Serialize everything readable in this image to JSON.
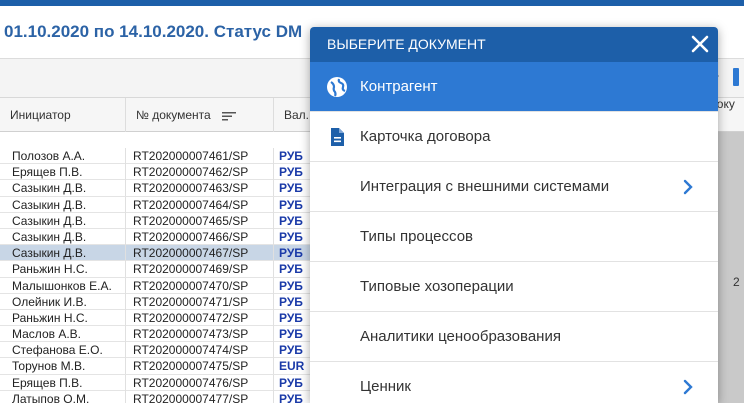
{
  "page": {
    "title": "01.10.2020 по 14.10.2020. Статус DM"
  },
  "table": {
    "columns": [
      "Инициатор",
      "№ документа",
      "Вал."
    ],
    "right_header": "атоку",
    "right_value": "2",
    "rows": [
      {
        "initiator": "Полозов А.А.",
        "doc": "RT202000007461/SP",
        "cur": "РУБ"
      },
      {
        "initiator": "Ерящев П.В.",
        "doc": "RT202000007462/SP",
        "cur": "РУБ"
      },
      {
        "initiator": "Сазыкин Д.В.",
        "doc": "RT202000007463/SP",
        "cur": "РУБ"
      },
      {
        "initiator": "Сазыкин Д.В.",
        "doc": "RT202000007464/SP",
        "cur": "РУБ"
      },
      {
        "initiator": "Сазыкин Д.В.",
        "doc": "RT202000007465/SP",
        "cur": "РУБ"
      },
      {
        "initiator": "Сазыкин Д.В.",
        "doc": "RT202000007466/SP",
        "cur": "РУБ"
      },
      {
        "initiator": "Сазыкин Д.В.",
        "doc": "RT202000007467/SP",
        "cur": "РУБ"
      },
      {
        "initiator": "Раньжин Н.С.",
        "doc": "RT202000007469/SP",
        "cur": "РУБ"
      },
      {
        "initiator": "Малышонков Е.А.",
        "doc": "RT202000007470/SP",
        "cur": "РУБ"
      },
      {
        "initiator": "Олейник И.В.",
        "doc": "RT202000007471/SP",
        "cur": "РУБ"
      },
      {
        "initiator": "Раньжин Н.С.",
        "doc": "RT202000007472/SP",
        "cur": "РУБ"
      },
      {
        "initiator": "Маслов А.В.",
        "doc": "RT202000007473/SP",
        "cur": "РУБ"
      },
      {
        "initiator": "Стефанова Е.О.",
        "doc": "RT202000007474/SP",
        "cur": "РУБ"
      },
      {
        "initiator": "Торунов М.В.",
        "doc": "RT202000007475/SP",
        "cur": "EUR"
      },
      {
        "initiator": "Ерящев П.В.",
        "doc": "RT202000007476/SP",
        "cur": "РУБ"
      },
      {
        "initiator": "Латыпов О.М.",
        "doc": "RT202000007477/SP",
        "cur": "РУБ"
      }
    ],
    "selected_row": 6
  },
  "modal": {
    "title": "ВЫБЕРИТЕ ДОКУМЕНТ",
    "items": [
      {
        "label": "Контрагент",
        "icon": "globe-icon",
        "active": true,
        "submenu": false
      },
      {
        "label": "Карточка договора",
        "icon": "document-icon",
        "active": false,
        "submenu": false
      },
      {
        "label": "Интеграция с внешними системами",
        "icon": "",
        "active": false,
        "submenu": true
      },
      {
        "label": "Типы процессов",
        "icon": "",
        "active": false,
        "submenu": false
      },
      {
        "label": "Типовые хозоперации",
        "icon": "",
        "active": false,
        "submenu": false
      },
      {
        "label": "Аналитики ценообразования",
        "icon": "",
        "active": false,
        "submenu": false
      },
      {
        "label": "Ценник",
        "icon": "",
        "active": false,
        "submenu": true
      }
    ]
  },
  "colors": {
    "brand": "#1d5fa9",
    "active_item": "#2d79d3",
    "currency_text": "#1a3aa8"
  }
}
